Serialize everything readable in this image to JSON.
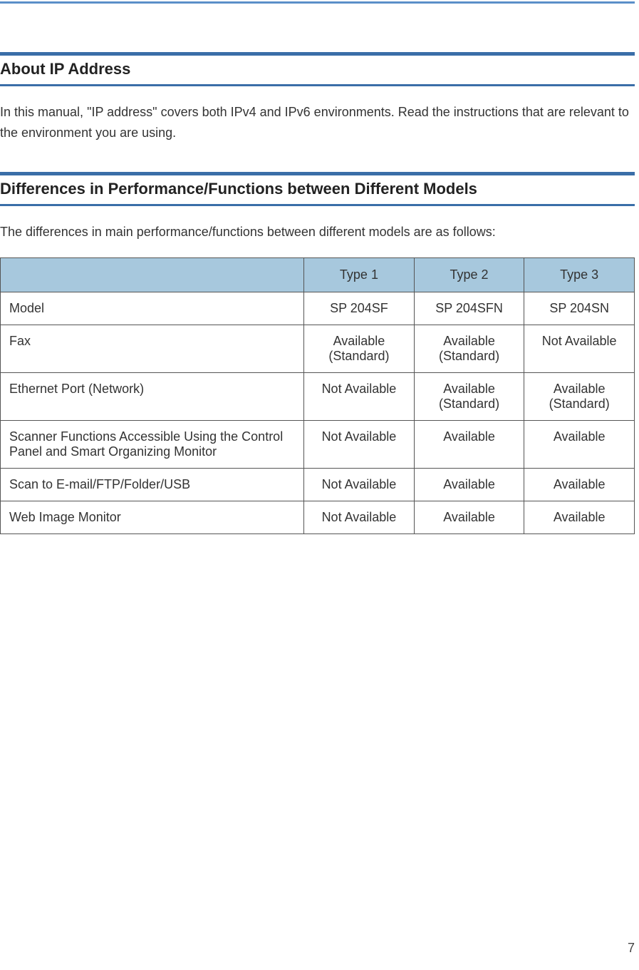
{
  "section1": {
    "heading": "About IP Address",
    "text": "In this manual, \"IP address\" covers both IPv4 and IPv6 environments. Read the instructions that are relevant to the environment you are using."
  },
  "section2": {
    "heading": "Differences in Performance/Functions between Different Models",
    "intro": "The differences in main performance/functions between different models are as follows:"
  },
  "chart_data": {
    "type": "table",
    "header_blank": "",
    "columns": [
      "Type 1",
      "Type 2",
      "Type 3"
    ],
    "rows": [
      {
        "feature": "Model",
        "values": [
          "SP 204SF",
          "SP 204SFN",
          "SP 204SN"
        ]
      },
      {
        "feature": "Fax",
        "values": [
          "Available (Standard)",
          "Available (Standard)",
          "Not Available"
        ]
      },
      {
        "feature": "Ethernet Port (Network)",
        "values": [
          "Not Available",
          "Available (Standard)",
          "Available (Standard)"
        ]
      },
      {
        "feature": "Scanner Functions Accessible Using the Control Panel and Smart Organizing Monitor",
        "values": [
          "Not Available",
          "Available",
          "Available"
        ]
      },
      {
        "feature": "Scan to E-mail/FTP/Folder/USB",
        "values": [
          "Not Available",
          "Available",
          "Available"
        ]
      },
      {
        "feature": "Web Image Monitor",
        "values": [
          "Not Available",
          "Available",
          "Available"
        ]
      }
    ]
  },
  "page_number": "7"
}
